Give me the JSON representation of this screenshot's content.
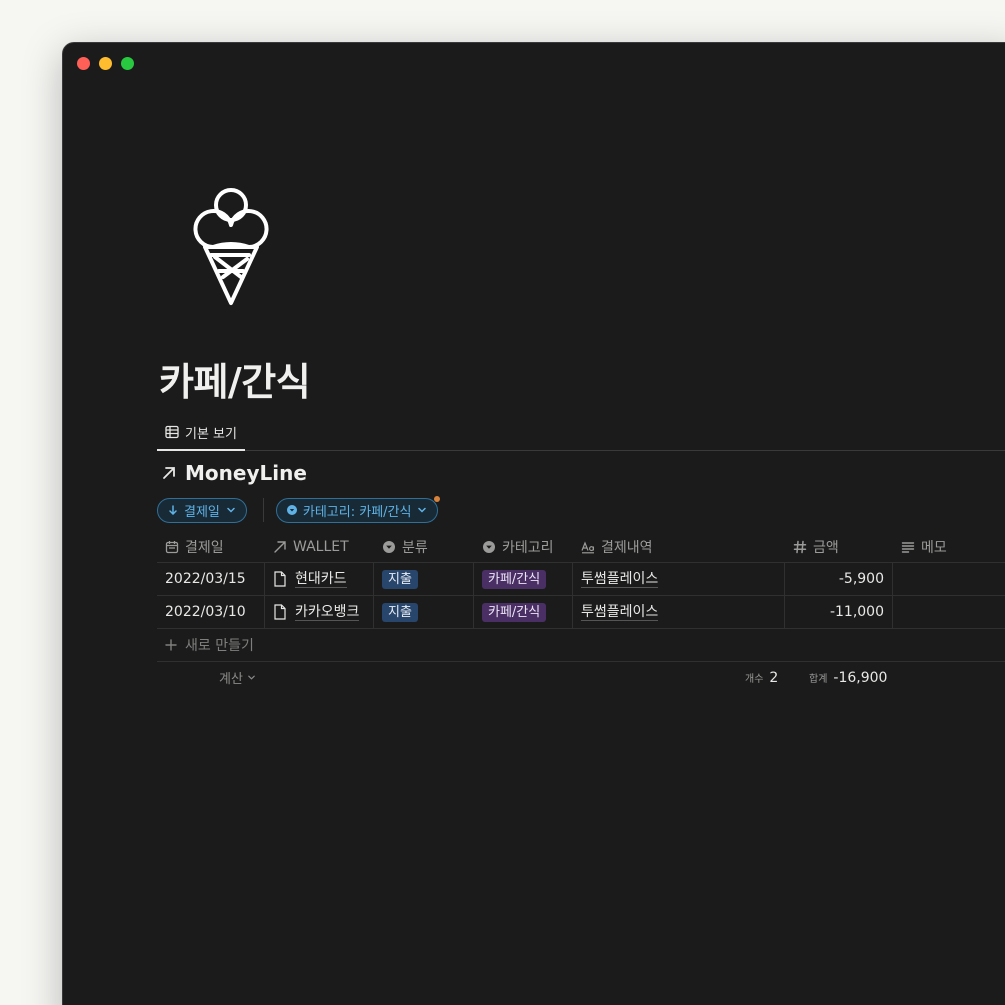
{
  "page": {
    "icon": "ice-cream-icon",
    "title": "카페/간식"
  },
  "view_tab": {
    "label": "기본 보기",
    "icon": "table-icon"
  },
  "database": {
    "title": "MoneyLine",
    "icon": "arrow-up-right-icon"
  },
  "filters": [
    {
      "label": "결제일",
      "icon": "arrow-down-icon"
    },
    {
      "label": "카테고리: 카페/간식",
      "icon": "select-icon"
    }
  ],
  "columns": [
    {
      "label": "결제일",
      "icon": "calendar-icon"
    },
    {
      "label": "WALLET",
      "icon": "relation-arrow-icon"
    },
    {
      "label": "분류",
      "icon": "select-icon"
    },
    {
      "label": "카테고리",
      "icon": "select-icon"
    },
    {
      "label": "결제내역",
      "icon": "text-aa-icon"
    },
    {
      "label": "금액",
      "icon": "hash-icon"
    },
    {
      "label": "메모",
      "icon": "lines-icon"
    }
  ],
  "rows": [
    {
      "date": "2022/03/15",
      "wallet": "현대카드",
      "type": "지출",
      "category": "카페/간식",
      "detail": "투썸플레이스",
      "amount": "-5,900",
      "memo": ""
    },
    {
      "date": "2022/03/10",
      "wallet": "카카오뱅크",
      "type": "지출",
      "category": "카페/간식",
      "detail": "투썸플레이스",
      "amount": "-11,000",
      "memo": ""
    }
  ],
  "new_row_label": "새로 만들기",
  "calc": {
    "label": "계산",
    "count_key": "개수",
    "count_value": "2",
    "sum_key": "합계",
    "sum_value": "-16,900"
  },
  "colors": {
    "background": "#1b1b1b",
    "chip_accent": "#5fb2e6",
    "tag_blue": "#28456c",
    "tag_purple": "#492f64"
  }
}
